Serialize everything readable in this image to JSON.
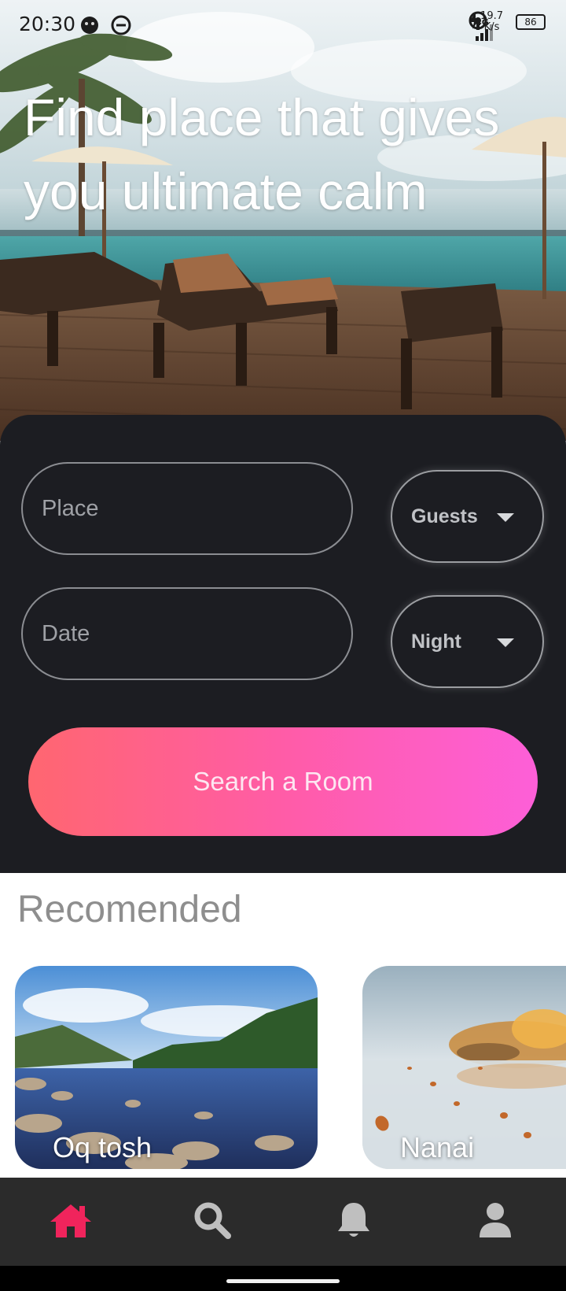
{
  "status_bar": {
    "time": "20:30",
    "network": "4G",
    "speed_value": "19.7",
    "speed_unit": "K/s",
    "battery": "86"
  },
  "hero": {
    "title": "Find place that gives you ultimate calm"
  },
  "search": {
    "place_placeholder": "Place",
    "date_placeholder": "Date",
    "guests_label": "Guests",
    "night_label": "Night",
    "button_label": "Search a Room"
  },
  "recommended": {
    "title": "Recomended",
    "cards": [
      {
        "label": "Oq tosh"
      },
      {
        "label": "Nanai"
      }
    ]
  },
  "bottom_nav": {
    "items": [
      {
        "icon": "home-icon",
        "active": true
      },
      {
        "icon": "search-icon",
        "active": false
      },
      {
        "icon": "bell-icon",
        "active": false
      },
      {
        "icon": "profile-icon",
        "active": false
      }
    ]
  },
  "colors": {
    "panel_bg": "#1c1d22",
    "accent_active": "#f0245c",
    "button_gradient_start": "#ff6670",
    "button_gradient_end": "#fd5fd8",
    "nav_bg": "#2b2b2b",
    "nav_icon": "#bfbfbf"
  }
}
